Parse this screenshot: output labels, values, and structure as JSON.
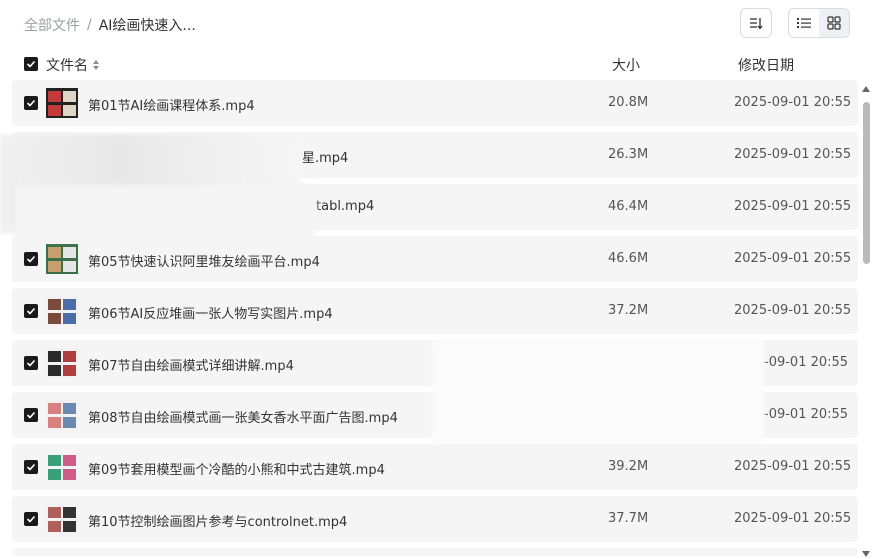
{
  "breadcrumb": {
    "root": "全部文件",
    "separator": "/",
    "current": "AI绘画快速入..."
  },
  "header": {
    "name": "文件名",
    "size": "大小",
    "date": "修改日期"
  },
  "files": [
    {
      "name": "第01节AI绘画课程体系.mp4",
      "size": "20.8M",
      "date": "2025-09-01 20:55",
      "thumb": [
        "#222222",
        "#c23a3a",
        "#e0d6c8"
      ]
    },
    {
      "name": "星.mp4",
      "size": "26.3M",
      "date": "2025-09-01 20:55",
      "thumb": [
        "#e0e0e0",
        "#cccccc",
        "#d8d8d8"
      ]
    },
    {
      "name": "tabl.mp4",
      "size": "46.4M",
      "date": "2025-09-01 20:55",
      "thumb": [
        "#e0e0e0",
        "#cccccc",
        "#d8d8d8"
      ]
    },
    {
      "name": "第05节快速认识阿里堆友绘画平台.mp4",
      "size": "46.6M",
      "date": "2025-09-01 20:55",
      "thumb": [
        "#3a6f4a",
        "#c8a070",
        "#e6e6e6"
      ]
    },
    {
      "name": "第06节AI反应堆画一张人物写实图片.mp4",
      "size": "37.2M",
      "date": "2025-09-01 20:55",
      "thumb": [
        "#f2f2f2",
        "#7a4a3a",
        "#4a6fa8"
      ]
    },
    {
      "name": "第07节自由绘画模式详细讲解.mp4",
      "size": "",
      "date": "-09-01 20:55",
      "thumb": [
        "#f2f2f2",
        "#2a2a2a",
        "#b04040"
      ]
    },
    {
      "name": "第08节自由绘画模式画一张美女香水平面广告图.mp4",
      "size": "",
      "date": "-09-01 20:55",
      "thumb": [
        "#f2f2f2",
        "#d88080",
        "#6a8ab0"
      ]
    },
    {
      "name": "第09节套用模型画个冷酷的小熊和中式古建筑.mp4",
      "size": "39.2M",
      "date": "2025-09-01 20:55",
      "thumb": [
        "#f4f4f4",
        "#3aa07a",
        "#d05a8a"
      ]
    },
    {
      "name": "第10节控制绘画图片参考与controlnet.mp4",
      "size": "37.7M",
      "date": "2025-09-01 20:55",
      "thumb": [
        "#f4f4f4",
        "#b0605a",
        "#333333"
      ]
    }
  ]
}
